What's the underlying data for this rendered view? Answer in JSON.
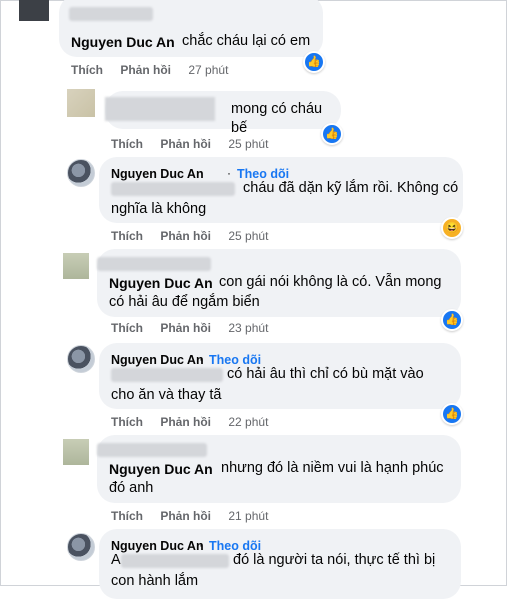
{
  "actions": {
    "like": "Thích",
    "reply": "Phản hồi",
    "follow": "Theo dõi"
  },
  "comments": [
    {
      "author": "Nguyen Duc An",
      "text": "chắc cháu lại có em",
      "time": "27 phút"
    },
    {
      "author": "",
      "text": "mong có cháu bế",
      "time": "25 phút"
    },
    {
      "author": "Nguyen Duc An",
      "text_line1": "cháu đã dặn kỹ lắm rồi. Không có",
      "text_line2": "nghĩa là không",
      "time": "25 phút"
    },
    {
      "author": "Nguyen Duc An",
      "text_line1": "con gái nói không là có. Vẫn mong",
      "text_line2": "có hải âu để ngắm biển",
      "time": "23 phút"
    },
    {
      "author": "Nguyen Duc An",
      "text_line1": "có hải âu thì chỉ có bù mặt vào",
      "text_line2": "cho ăn và thay tã",
      "time": "22 phút"
    },
    {
      "author": "Nguyen Duc An",
      "text_line1": "nhưng đó là niềm vui là hạnh phúc",
      "text_line2": "đó anh",
      "time": "21 phút"
    },
    {
      "author": "Nguyen Duc An",
      "prefix": "A",
      "text_line1": "đó là người ta nói, thực tế thì bị",
      "text_line2": "con hành lắm"
    }
  ],
  "icons": {
    "like": "like-reaction-icon",
    "haha": "haha-reaction-icon"
  },
  "colors": {
    "accent": "#1877f2",
    "bubble": "#f0f2f5",
    "meta": "#65676b"
  }
}
